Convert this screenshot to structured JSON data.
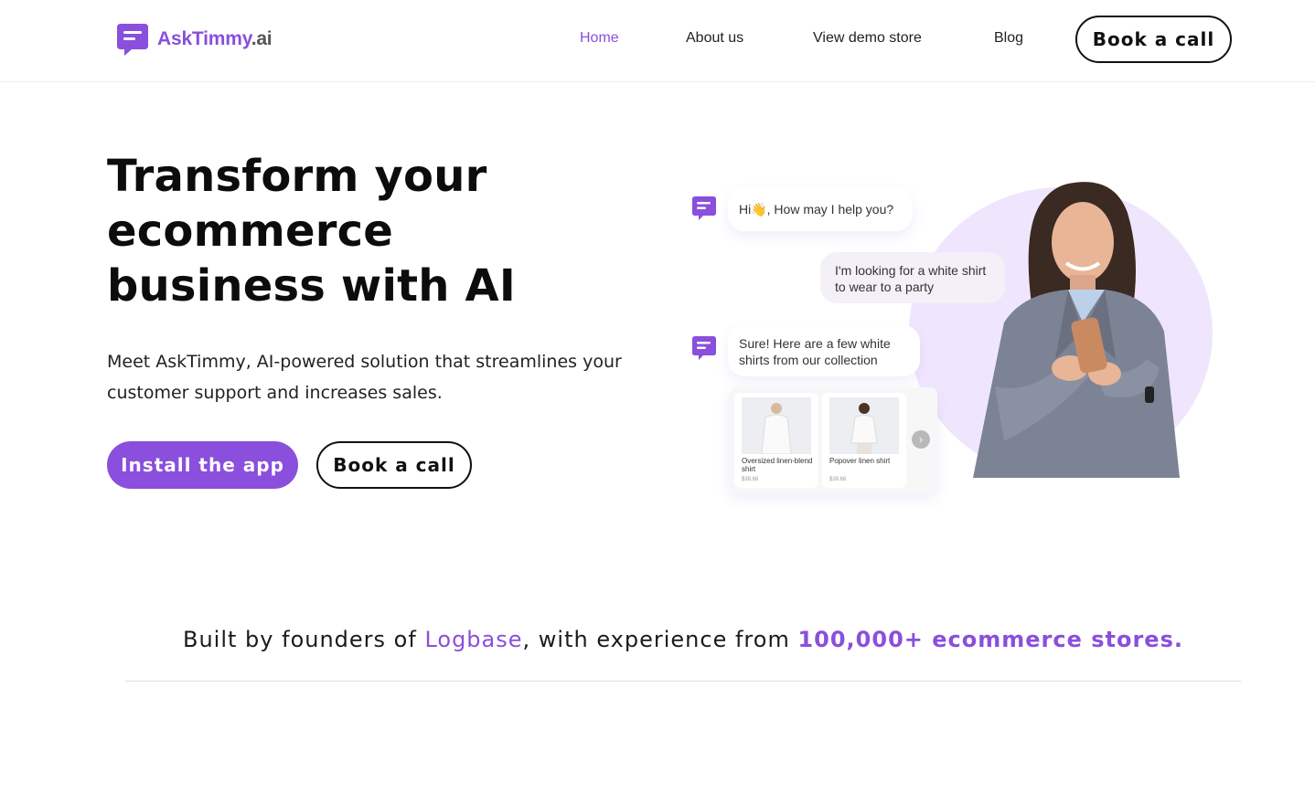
{
  "header": {
    "logo": {
      "text_main": "AskTimmy",
      "text_suffix": ".ai",
      "icon": "chat-bubble-icon"
    },
    "nav": [
      {
        "label": "Home",
        "active": true
      },
      {
        "label": "About us",
        "active": false
      },
      {
        "label": "View demo store",
        "active": false
      },
      {
        "label": "Blog",
        "active": false
      }
    ],
    "cta_label": "Book a call"
  },
  "hero": {
    "title": "Transform your ecommerce business with AI",
    "description": "Meet AskTimmy, AI-powered solution that streamlines your customer support and increases sales.",
    "primary_button": "Install the app",
    "secondary_button": "Book a call"
  },
  "chat_demo": {
    "bot_greeting": "Hi👋, How may I help you?",
    "user_message": "I'm looking for a white shirt to wear to a party",
    "bot_reply": "Sure! Here are a few white shirts from our collection",
    "products": [
      {
        "name": "Oversized linen-blend shirt",
        "price": "$39.66"
      },
      {
        "name": "Popover linen shirt",
        "price": "$39.66"
      }
    ],
    "next_icon": "chevron-right-icon"
  },
  "founders": {
    "prefix": "Built by founders of ",
    "company": "Logbase",
    "middle": ", with experience from ",
    "highlight": "100,000+ ecommerce stores."
  },
  "colors": {
    "accent": "#8a4fdc",
    "blob": "#efe6fd",
    "text": "#111111"
  }
}
